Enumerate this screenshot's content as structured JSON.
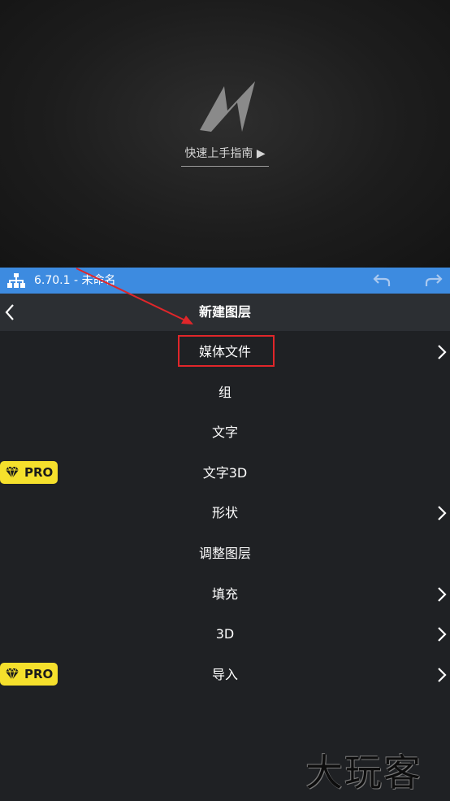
{
  "preview": {
    "guide_label": "快速上手指南 ▶"
  },
  "toolbar": {
    "version": "6.70.1 - 未命名",
    "icons": {
      "tree": "layer-tree-icon",
      "undo": "undo-icon",
      "redo": "redo-icon"
    },
    "color": "#3d8be0"
  },
  "header": {
    "title": "新建图层",
    "back_icon": "chevron-left-icon"
  },
  "menu": {
    "items": [
      {
        "label": "媒体文件",
        "has_submenu": true,
        "pro": false
      },
      {
        "label": "组",
        "has_submenu": false,
        "pro": false
      },
      {
        "label": "文字",
        "has_submenu": false,
        "pro": false
      },
      {
        "label": "文字3D",
        "has_submenu": false,
        "pro": true
      },
      {
        "label": "形状",
        "has_submenu": true,
        "pro": false
      },
      {
        "label": "调整图层",
        "has_submenu": false,
        "pro": false
      },
      {
        "label": "填充",
        "has_submenu": true,
        "pro": false
      },
      {
        "label": "3D",
        "has_submenu": true,
        "pro": false
      },
      {
        "label": "导入",
        "has_submenu": true,
        "pro": true
      }
    ]
  },
  "badge": {
    "text": "PRO",
    "color": "#f5e02c",
    "icon": "diamond-icon"
  },
  "annotation": {
    "highlight_color": "#e0262a"
  },
  "watermark": {
    "text": "大玩客"
  }
}
